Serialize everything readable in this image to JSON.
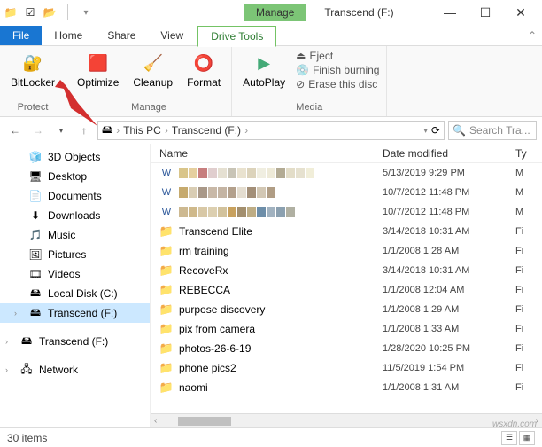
{
  "window": {
    "title": "Transcend (F:)",
    "contextual_tab_group": "Manage",
    "item_count": "30 items",
    "watermark": "wsxdn.com"
  },
  "tabs": {
    "file": "File",
    "home": "Home",
    "share": "Share",
    "view": "View",
    "drive_tools": "Drive Tools"
  },
  "ribbon": {
    "protect_group": "Protect",
    "manage_group": "Manage",
    "media_group": "Media",
    "bitlocker": "BitLocker",
    "optimize": "Optimize",
    "cleanup": "Cleanup",
    "format": "Format",
    "autoplay": "AutoPlay",
    "eject": "Eject",
    "finish_burning": "Finish burning",
    "erase_disc": "Erase this disc"
  },
  "address": {
    "root": "This PC",
    "current": "Transcend (F:)",
    "search_placeholder": "Search Tra..."
  },
  "nav": {
    "items": [
      {
        "label": "3D Objects",
        "icon": "🧊"
      },
      {
        "label": "Desktop",
        "icon": "🖥"
      },
      {
        "label": "Documents",
        "icon": "📄"
      },
      {
        "label": "Downloads",
        "icon": "⬇"
      },
      {
        "label": "Music",
        "icon": "🎵"
      },
      {
        "label": "Pictures",
        "icon": "🖼"
      },
      {
        "label": "Videos",
        "icon": "🎞"
      },
      {
        "label": "Local Disk (C:)",
        "icon": "🖴"
      },
      {
        "label": "Transcend (F:)",
        "icon": "🖴"
      }
    ],
    "transcend2": "Transcend (F:)",
    "network": "Network"
  },
  "columns": {
    "name": "Name",
    "date": "Date modified",
    "type": "Ty"
  },
  "files": [
    {
      "kind": "blur",
      "icon": "doc",
      "date": "5/13/2019 9:29 PM",
      "type": "M"
    },
    {
      "kind": "blur",
      "icon": "doc",
      "date": "10/7/2012 11:48 PM",
      "type": "M"
    },
    {
      "kind": "blur",
      "icon": "doc",
      "date": "10/7/2012 11:48 PM",
      "type": "M"
    },
    {
      "kind": "text",
      "icon": "folder",
      "name": "Transcend Elite",
      "date": "3/14/2018 10:31 AM",
      "type": "Fi"
    },
    {
      "kind": "text",
      "icon": "folder",
      "name": "rm training",
      "date": "1/1/2008 1:28 AM",
      "type": "Fi"
    },
    {
      "kind": "text",
      "icon": "folder",
      "name": "RecoveRx",
      "date": "3/14/2018 10:31 AM",
      "type": "Fi"
    },
    {
      "kind": "text",
      "icon": "folder",
      "name": "REBECCA",
      "date": "1/1/2008 12:04 AM",
      "type": "Fi"
    },
    {
      "kind": "text",
      "icon": "folder",
      "name": "purpose discovery",
      "date": "1/1/2008 1:29 AM",
      "type": "Fi"
    },
    {
      "kind": "text",
      "icon": "folder",
      "name": "pix from camera",
      "date": "1/1/2008 1:33 AM",
      "type": "Fi"
    },
    {
      "kind": "text",
      "icon": "folder",
      "name": "photos-26-6-19",
      "date": "1/28/2020 10:25 PM",
      "type": "Fi"
    },
    {
      "kind": "text",
      "icon": "folder",
      "name": "phone pics2",
      "date": "11/5/2019 1:54 PM",
      "type": "Fi"
    },
    {
      "kind": "text",
      "icon": "folder",
      "name": "naomi",
      "date": "1/1/2008 1:31 AM",
      "type": "Fi"
    }
  ],
  "blur_colors": [
    [
      "#d9c58a",
      "#e5cf9f",
      "#c77e7e",
      "#e0cece",
      "#e5e0d2",
      "#c8c4b6",
      "#e9e2cf",
      "#dcd3bb",
      "#f0eee1",
      "#eeead8",
      "#b3ab94",
      "#e3ddc8",
      "#e6e1cf",
      "#f1eed9"
    ],
    [
      "#c6aa6e",
      "#d9cdb4",
      "#a99888",
      "#c8b8a7",
      "#c4b4a3",
      "#b3a08c",
      "#e4ddd0",
      "#a38f78",
      "#d2c7b4",
      "#b09d85"
    ],
    [
      "#cdb991",
      "#cfb98b",
      "#d8c8a6",
      "#dccfb0",
      "#d2c29c",
      "#c8a15e",
      "#a38f6e",
      "#bead85",
      "#6d8ea9",
      "#a1b2c0",
      "#8ba0b0",
      "#b0b0a2"
    ]
  ]
}
